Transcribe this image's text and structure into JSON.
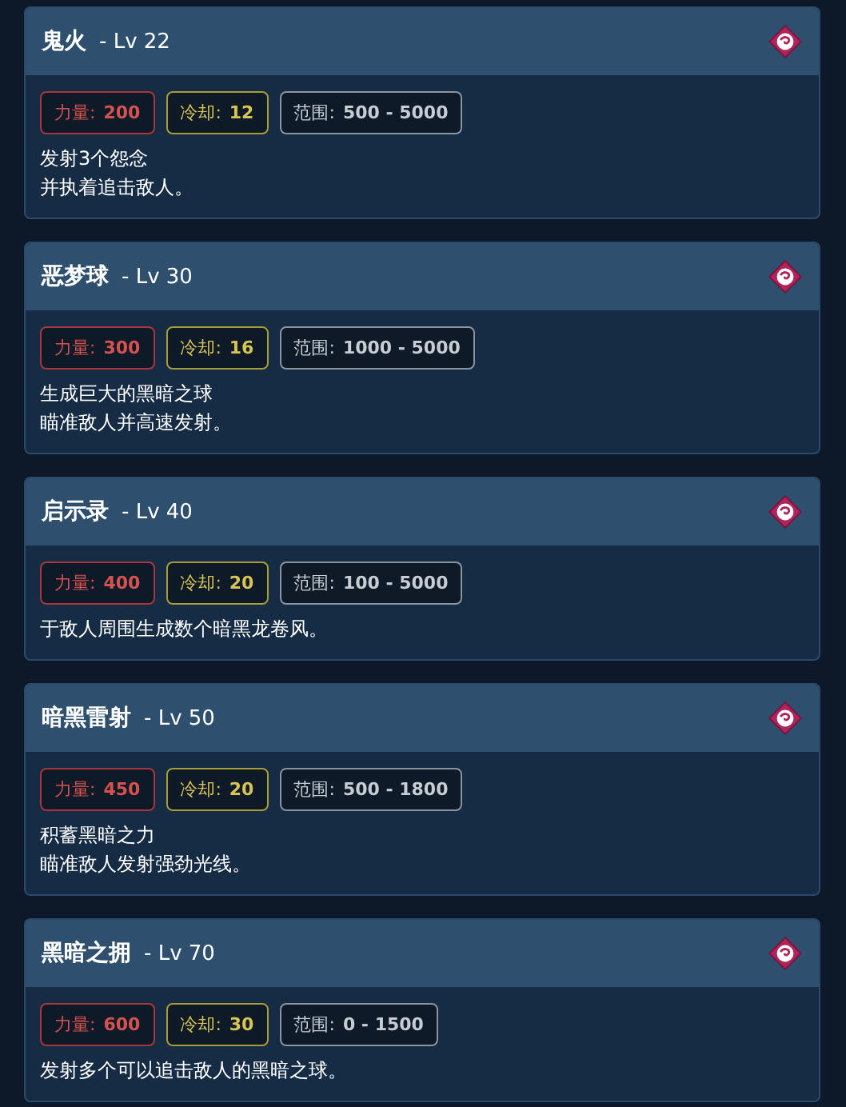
{
  "skills": [
    {
      "name": "鬼火",
      "level": "- Lv 22",
      "stats": [
        {
          "kind": "power",
          "label": "力量:",
          "value": "200"
        },
        {
          "kind": "cooldown",
          "label": "冷却:",
          "value": "12"
        },
        {
          "kind": "range",
          "label": "范围:",
          "value": "500 - 5000"
        }
      ],
      "description": [
        "发射3个怨念",
        "并执着追击敌人。"
      ]
    },
    {
      "name": "恶梦球",
      "level": "- Lv 30",
      "stats": [
        {
          "kind": "power",
          "label": "力量:",
          "value": "300"
        },
        {
          "kind": "cooldown",
          "label": "冷却:",
          "value": "16"
        },
        {
          "kind": "range",
          "label": "范围:",
          "value": "1000 - 5000"
        }
      ],
      "description": [
        "生成巨大的黑暗之球",
        "瞄准敌人并高速发射。"
      ]
    },
    {
      "name": "启示录",
      "level": "- Lv 40",
      "stats": [
        {
          "kind": "power",
          "label": "力量:",
          "value": "400"
        },
        {
          "kind": "cooldown",
          "label": "冷却:",
          "value": "20"
        },
        {
          "kind": "range",
          "label": "范围:",
          "value": "100 - 5000"
        }
      ],
      "description": [
        "于敌人周围生成数个暗黑龙卷风。"
      ]
    },
    {
      "name": "暗黑雷射",
      "level": "- Lv 50",
      "stats": [
        {
          "kind": "power",
          "label": "力量:",
          "value": "450"
        },
        {
          "kind": "cooldown",
          "label": "冷却:",
          "value": "20"
        },
        {
          "kind": "range",
          "label": "范围:",
          "value": "500 - 1800"
        }
      ],
      "description": [
        "积蓄黑暗之力",
        "瞄准敌人发射强劲光线。"
      ]
    },
    {
      "name": "黑暗之拥",
      "level": "- Lv 70",
      "stats": [
        {
          "kind": "power",
          "label": "力量:",
          "value": "600"
        },
        {
          "kind": "cooldown",
          "label": "冷却:",
          "value": "30"
        },
        {
          "kind": "range",
          "label": "范围:",
          "value": "0 - 1500"
        }
      ],
      "description": [
        "发射多个可以追击敌人的黑暗之球。"
      ]
    }
  ]
}
